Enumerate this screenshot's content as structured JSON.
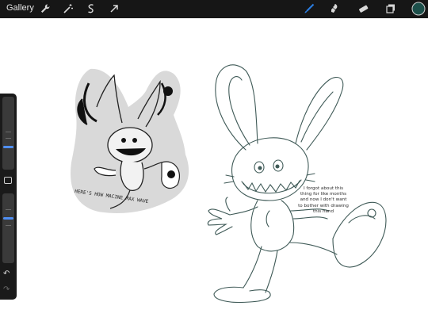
{
  "toolbar": {
    "gallery_label": "Gallery",
    "left_tools": [
      "wrench-icon",
      "magic-wand-icon",
      "selection-icon",
      "transform-arrow-icon"
    ],
    "right_tools": [
      "brush-icon",
      "smudge-icon",
      "eraser-icon",
      "layers-icon",
      "color-swatch-icon"
    ],
    "active_color": "#1c4f4a",
    "brush_active_color": "#2a7de1"
  },
  "canvas": {
    "note_text": "I forgot about this thing for like months and now I don't want to bother with drawing this hand",
    "reference_text": "HERE'S HOW MACINE MAX WAVE"
  },
  "sidebar": {
    "size_slider_value": 0.35,
    "opacity_slider_value": 0.3,
    "undo_icon": "undo-icon",
    "redo_icon": "redo-icon"
  }
}
